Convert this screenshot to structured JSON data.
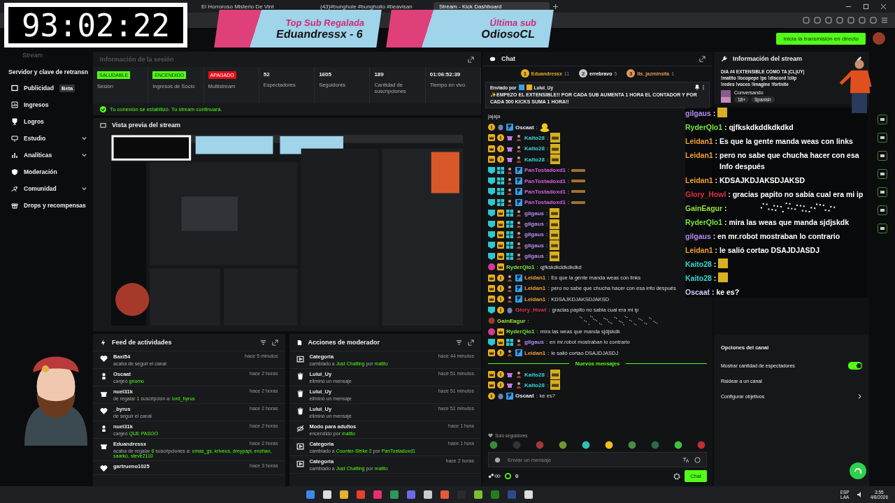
{
  "browser": {
    "tabs": [
      {
        "label": "El Horroroso Misterio De Vint",
        "selected": false
      },
      {
        "label": "(43)#bunghole #bungholio #beavisan",
        "selected": false
      },
      {
        "label": "Stream - Kick Dashboard",
        "selected": true
      }
    ]
  },
  "header": {
    "go_live": "Inicia la transmisión en directo"
  },
  "overlay": {
    "timer": "93:02:22",
    "banners": [
      {
        "title": "Top Sub Regalada",
        "value": "Eduandressx - 6"
      },
      {
        "title": "Última sub",
        "value": "OdiosoCL"
      }
    ]
  },
  "sidebar": {
    "stream": "Stream",
    "sub_item": "Servidor y clave de retransn",
    "items": [
      {
        "label": "Publicidad",
        "badge": "Beta",
        "kind": "ads"
      },
      {
        "label": "Ingresos",
        "kind": "revenue"
      },
      {
        "label": "Logros",
        "kind": "trophy"
      },
      {
        "label": "Estudio",
        "kind": "studio",
        "expanded": false
      },
      {
        "label": "Analíticas",
        "kind": "chart",
        "expanded": false
      },
      {
        "label": "Moderación",
        "kind": "shield"
      },
      {
        "label": "Comunidad",
        "kind": "people",
        "expanded": false
      },
      {
        "label": "Drops y recompensas",
        "kind": "gift"
      }
    ]
  },
  "session": {
    "title": "Información de la sesión",
    "stats": [
      {
        "kind": "status",
        "value": "SALUDABLE",
        "color": "#53fc18",
        "label": "Sesión"
      },
      {
        "kind": "status",
        "value": "ENCENDIDO",
        "color": "#53fc18",
        "label": "Ingresos de Socio"
      },
      {
        "kind": "status",
        "value": "APAGADO",
        "color": "#e0101a",
        "label": "Multistream"
      },
      {
        "kind": "number",
        "value": "52",
        "label": "Espectadores"
      },
      {
        "kind": "number",
        "value": "1605",
        "label": "Seguidores"
      },
      {
        "kind": "number",
        "value": "189",
        "label": "Cantidad de suscripciones"
      },
      {
        "kind": "number",
        "value": "01:06:52:39",
        "label": "Tiempo en vivo"
      }
    ],
    "notice": "Tu conexión se estabilizó. Tu stream continuará."
  },
  "preview": {
    "title": "Vista previa del stream",
    "kind": "picture"
  },
  "feed": {
    "title": "Feed de actividades",
    "items": [
      {
        "kind": "follow",
        "user": "Baxi54",
        "time": "hace 5 minutos",
        "detail": [
          {
            "text": "acaba de seguir el canal",
            "highlight": false
          }
        ]
      },
      {
        "kind": "redeem",
        "user": "Oscaat",
        "time": "hace 2 horas",
        "detail": [
          {
            "text": "canjeó",
            "highlight": false
          },
          {
            "text": "gnomo",
            "highlight": true
          }
        ]
      },
      {
        "kind": "gift",
        "user": "nuel31k",
        "time": "hace 2 horas",
        "detail": [
          {
            "text": "de regalar",
            "highlight": false
          },
          {
            "text": "1",
            "highlight": true
          },
          {
            "text": "suscripción a:",
            "highlight": false
          },
          {
            "text": "lord_byrus",
            "highlight": true
          }
        ]
      },
      {
        "kind": "follow",
        "user": "_byrus",
        "time": "hace 2 horas",
        "detail": [
          {
            "text": "de seguir el canal",
            "highlight": false
          }
        ]
      },
      {
        "kind": "redeem",
        "user": "nuel31k",
        "time": "hace 2 horas",
        "detail": [
          {
            "text": "canjeó",
            "highlight": false
          },
          {
            "text": "QUE PASOO",
            "highlight": true
          }
        ]
      },
      {
        "kind": "gift",
        "user": "Eduandressx",
        "time": "hace 2 horas",
        "detail": [
          {
            "text": "acaba de regalar",
            "highlight": false
          },
          {
            "text": "6",
            "highlight": true
          },
          {
            "text": "suscripciones a:",
            "highlight": false
          },
          {
            "text": "omas_gs, kriveus, dreypapi, enzhan, saarko, steve2110",
            "highlight": true
          }
        ]
      },
      {
        "kind": "follow",
        "user": "gartrueno1025",
        "time": "hace 3 horas"
      }
    ]
  },
  "mod_actions": {
    "title": "Acciones de moderador",
    "items": [
      {
        "kind": "category",
        "title": "Categoria",
        "time": "hace 44 minutos",
        "detail": [
          {
            "text": "cambiado a",
            "highlight": false
          },
          {
            "text": "Just Chatting",
            "highlight": true
          },
          {
            "text": "por",
            "highlight": false
          },
          {
            "text": "matito",
            "highlight": true
          }
        ]
      },
      {
        "kind": "delete",
        "title": "Lului_Uy",
        "time": "hace 51 minutos",
        "detail": [
          {
            "text": "eliminó un mensaje",
            "highlight": false
          }
        ]
      },
      {
        "kind": "delete",
        "title": "Lului_Uy",
        "time": "hace 51 minutos",
        "detail": [
          {
            "text": "eliminó un mensaje",
            "highlight": false
          }
        ]
      },
      {
        "kind": "delete",
        "title": "Lului_Uy",
        "time": "hace 51 minutos",
        "detail": [
          {
            "text": "eliminó un mensaje",
            "highlight": false
          }
        ]
      },
      {
        "kind": "adult",
        "title": "Modo para adultos",
        "time": "hace 1 hora",
        "detail": [
          {
            "text": "encendido por",
            "highlight": false
          },
          {
            "text": "matito",
            "highlight": true
          }
        ]
      },
      {
        "kind": "category",
        "title": "Categoria",
        "time": "hace 1 hora",
        "detail": [
          {
            "text": "cambiado a",
            "highlight": false
          },
          {
            "text": "Counter-Strike 2",
            "highlight": true
          },
          {
            "text": "por",
            "highlight": false
          },
          {
            "text": "PanTostadoxd1",
            "highlight": true
          }
        ]
      },
      {
        "kind": "category",
        "title": "Categoria",
        "time": "hace 2 horas",
        "detail": [
          {
            "text": "cambiado a",
            "highlight": false
          },
          {
            "text": "Just Chatting",
            "highlight": true
          },
          {
            "text": "por",
            "highlight": false
          },
          {
            "text": "matito",
            "highlight": true
          }
        ]
      }
    ]
  },
  "chat": {
    "title": "Chat",
    "separator": ":",
    "leaders": [
      {
        "rank": "1",
        "user": "Eduandressx",
        "count": "11",
        "color": "#e8b020"
      },
      {
        "rank": "2",
        "user": "errebravo",
        "count": "5",
        "color": "#c8c8c8"
      },
      {
        "rank": "3",
        "user": "its_jazminsita",
        "count": "1",
        "color": "#e09a5a"
      }
    ],
    "pinned": {
      "label": "Enviado por",
      "user": "Lului_Uy",
      "text": "✨EMPEZO EL EXTENSIBLE!! POR CADA SUB AUMENTA 1 HORA EL CONTADOR Y POR CADA 500 KICKS SUMA 1 HORA!!"
    },
    "messages": [
      {
        "kind": "plain",
        "text": "jajaja"
      },
      {
        "kind": "emote_duck",
        "user": "Oscaat",
        "color": "#e4e8ff",
        "badges": [
          {
            "kind": "coin"
          },
          {
            "kind": "blob"
          },
          {
            "kind": "mod"
          }
        ]
      },
      {
        "kind": "emote",
        "user": "Kaito28",
        "color": "#35d6d6",
        "badges": [
          {
            "kind": "crown"
          },
          {
            "kind": "coin"
          },
          {
            "kind": "gift"
          },
          {
            "kind": "person"
          }
        ]
      },
      {
        "kind": "emote",
        "user": "Kaito28",
        "color": "#35d6d6",
        "badges": [
          {
            "kind": "crown"
          },
          {
            "kind": "coin"
          },
          {
            "kind": "gift"
          },
          {
            "kind": "person"
          }
        ]
      },
      {
        "kind": "emote",
        "user": "Kaito28",
        "color": "#35d6d6",
        "badges": [
          {
            "kind": "crown"
          },
          {
            "kind": "coin"
          },
          {
            "kind": "gift"
          },
          {
            "kind": "person"
          }
        ]
      },
      {
        "kind": "emote_wide",
        "user": "PanTostadoxd1",
        "color": "#d65fe0",
        "badges": [
          {
            "kind": "sub"
          },
          {
            "kind": "og"
          },
          {
            "kind": "person"
          },
          {
            "kind": "mod"
          }
        ]
      },
      {
        "kind": "emote_wide",
        "user": "PanTostadoxd1",
        "color": "#d65fe0",
        "badges": [
          {
            "kind": "sub"
          },
          {
            "kind": "og"
          },
          {
            "kind": "person"
          },
          {
            "kind": "mod"
          }
        ]
      },
      {
        "kind": "emote_wide",
        "user": "PanTostadoxd1",
        "color": "#d65fe0",
        "badges": [
          {
            "kind": "sub"
          },
          {
            "kind": "og"
          },
          {
            "kind": "person"
          },
          {
            "kind": "mod"
          }
        ]
      },
      {
        "kind": "emote_wide",
        "user": "PanTostadoxd1",
        "color": "#d65fe0",
        "badges": [
          {
            "kind": "sub"
          },
          {
            "kind": "og"
          },
          {
            "kind": "person"
          },
          {
            "kind": "mod"
          }
        ]
      },
      {
        "kind": "emote",
        "user": "gilgaus",
        "color": "#b38cf2",
        "badges": [
          {
            "kind": "sub"
          },
          {
            "kind": "crown"
          },
          {
            "kind": "og"
          },
          {
            "kind": "person"
          }
        ]
      },
      {
        "kind": "emote",
        "user": "gilgaus",
        "color": "#b38cf2",
        "badges": [
          {
            "kind": "sub"
          },
          {
            "kind": "crown"
          },
          {
            "kind": "og"
          },
          {
            "kind": "person"
          }
        ]
      },
      {
        "kind": "emote",
        "user": "gilgaus",
        "color": "#b38cf2",
        "badges": [
          {
            "kind": "sub"
          },
          {
            "kind": "crown"
          },
          {
            "kind": "og"
          },
          {
            "kind": "person"
          }
        ]
      },
      {
        "kind": "emote",
        "user": "gilgaus",
        "color": "#b38cf2",
        "badges": [
          {
            "kind": "sub"
          },
          {
            "kind": "crown"
          },
          {
            "kind": "og"
          },
          {
            "kind": "person"
          }
        ]
      },
      {
        "kind": "emote",
        "user": "gilgaus",
        "color": "#b38cf2",
        "badges": [
          {
            "kind": "sub"
          },
          {
            "kind": "crown"
          },
          {
            "kind": "og"
          },
          {
            "kind": "person"
          }
        ]
      },
      {
        "kind": "text",
        "user": "RyderQlo1",
        "color": "#75e83a",
        "text": "qjfkskdkddkdkdkd",
        "badges": [
          {
            "kind": "pink"
          },
          {
            "kind": "crown"
          }
        ]
      },
      {
        "kind": "text",
        "user": "Leidan1",
        "color": "#f0a030",
        "text": "Es que la gente manda weas con links",
        "badges": [
          {
            "kind": "crown"
          },
          {
            "kind": "coin"
          },
          {
            "kind": "person"
          },
          {
            "kind": "mod"
          }
        ]
      },
      {
        "kind": "text",
        "user": "Leidan1",
        "color": "#f0a030",
        "text": "pero no sabe que chucha hacer con esa info después",
        "badges": [
          {
            "kind": "crown"
          },
          {
            "kind": "coin"
          },
          {
            "kind": "person"
          },
          {
            "kind": "mod"
          }
        ]
      },
      {
        "kind": "text",
        "user": "Leidan1",
        "color": "#f0a030",
        "text": "KDSAJKDJAKSDJAKSD",
        "badges": [
          {
            "kind": "crown"
          },
          {
            "kind": "coin"
          },
          {
            "kind": "person"
          },
          {
            "kind": "mod"
          }
        ]
      },
      {
        "kind": "text",
        "user": "Glory_Howl",
        "color": "#e0304a",
        "text": "gracias papito no sabia cual era mi ip",
        "badges": [
          {
            "kind": "sub"
          },
          {
            "kind": "coin"
          },
          {
            "kind": "blob"
          }
        ]
      },
      {
        "kind": "ascii",
        "user": "GainEagur",
        "color": "#9be03a",
        "badges": [
          {
            "kind": "cap"
          }
        ]
      },
      {
        "kind": "text",
        "user": "RyderQlo1",
        "color": "#75e83a",
        "text": "mira las weas que manda sjdjskdk",
        "badges": [
          {
            "kind": "pink"
          },
          {
            "kind": "crown"
          }
        ]
      },
      {
        "kind": "text",
        "user": "gilgaus",
        "color": "#b38cf2",
        "text": "en mr.robot mostraban lo contrario",
        "badges": [
          {
            "kind": "sub"
          },
          {
            "kind": "crown"
          },
          {
            "kind": "og"
          },
          {
            "kind": "person"
          }
        ]
      },
      {
        "kind": "text",
        "user": "Leidan1",
        "color": "#f0a030",
        "text": "le salió cortao DSAJDJASDJ",
        "badges": [
          {
            "kind": "crown"
          },
          {
            "kind": "coin"
          },
          {
            "kind": "person"
          },
          {
            "kind": "mod"
          }
        ]
      },
      {
        "kind": "divider",
        "text": "Nuevos mensajes"
      },
      {
        "kind": "emote",
        "user": "Kaito28",
        "color": "#35d6d6",
        "badges": [
          {
            "kind": "crown"
          },
          {
            "kind": "coin"
          },
          {
            "kind": "gift"
          },
          {
            "kind": "person"
          }
        ]
      },
      {
        "kind": "emote",
        "user": "Kaito28",
        "color": "#35d6d6",
        "badges": [
          {
            "kind": "crown"
          },
          {
            "kind": "coin"
          },
          {
            "kind": "gift"
          },
          {
            "kind": "person"
          }
        ]
      },
      {
        "kind": "text",
        "user": "Oscaat",
        "color": "#e4e8ff",
        "text": "ke es?",
        "badges": [
          {
            "kind": "coin"
          },
          {
            "kind": "blob"
          },
          {
            "kind": "mod"
          }
        ]
      }
    ],
    "mode": "Solo seguidores",
    "placeholder": "Enviar un mensaje",
    "kicks": "0",
    "send": "Chat"
  },
  "info": {
    "title": "Información del stream",
    "stream_title": "DIA #4 EXTENSIBLE COMO TA |CL|UY| !matito !locopepe !pc !discord !clip !redes !voces !imagine !fortnite",
    "category": "Conversando",
    "tags": [
      "18+",
      "Spanish"
    ],
    "channel_title": "Opciones del canal",
    "channel_rows": [
      {
        "label": "Mostrar cantidad de espectadores",
        "kind": "toggle",
        "on": true
      },
      {
        "label": "Raidear a un canal",
        "kind": "plain"
      },
      {
        "label": "Configurar objetivos",
        "kind": "select"
      }
    ]
  },
  "stream_chat": {
    "separator": " : ",
    "lines": [
      {
        "user": "gilgaus",
        "color": "#b38cf2",
        "kind": "emote"
      },
      {
        "user": "RyderQlo1",
        "color": "#75e83a",
        "kind": "text",
        "text": "qjfkskdkddkdkdkd"
      },
      {
        "user": "Leidan1",
        "color": "#f0a030",
        "kind": "text",
        "text": "Es que la gente manda weas con links"
      },
      {
        "user": "Leidan1",
        "color": "#f0a030",
        "kind": "text",
        "text": "pero no sabe que chucha hacer con esa Info después"
      },
      {
        "user": "Leidan1",
        "color": "#f0a030",
        "kind": "text",
        "text": "KDSAJKDJAKSDJAKSD"
      },
      {
        "user": "Glory_Howl",
        "color": "#e0304a",
        "kind": "text",
        "text": "gracias papito no sabía cual era mi ip"
      },
      {
        "user": "GainEagur",
        "color": "#9be03a",
        "kind": "ascii"
      },
      {
        "user": "RyderQlo1",
        "color": "#75e83a",
        "kind": "text",
        "text": "mira las weas que manda sjdjskdk"
      },
      {
        "user": "gilgaus",
        "color": "#b38cf2",
        "kind": "text",
        "text": "en mr.robot mostraban lo contrario"
      },
      {
        "user": "Leidan1",
        "color": "#f0a030",
        "kind": "text",
        "text": "le salió cortao DSAJDJASDJ"
      },
      {
        "user": "Kaito28",
        "color": "#35d6d6",
        "kind": "emote"
      },
      {
        "user": "Kaito28",
        "color": "#35d6d6",
        "kind": "emote"
      },
      {
        "user": "Oscaat",
        "color": "#c9d2ff",
        "kind": "text",
        "text": "ke es?"
      }
    ]
  },
  "taskbar": {
    "lang": "ESP",
    "layout": "LAA",
    "time": "3:55",
    "date": "4/8/2026"
  }
}
